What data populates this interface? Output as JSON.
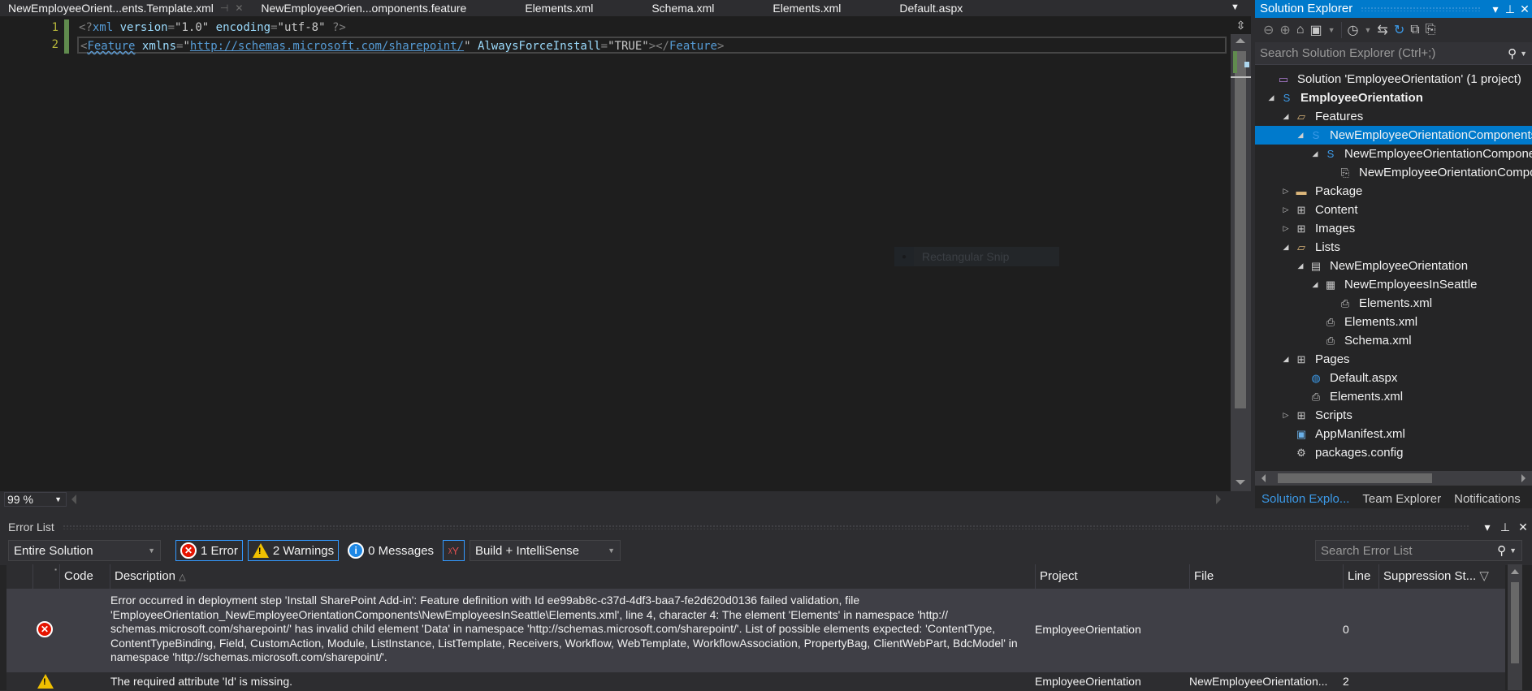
{
  "tabs": [
    {
      "label": "NewEmployeeOrient...ents.Template.xml",
      "active": true
    },
    {
      "label": "NewEmployeeOrien...omponents.feature"
    },
    {
      "label": "Elements.xml"
    },
    {
      "label": "Schema.xml"
    },
    {
      "label": "Elements.xml"
    },
    {
      "label": "Default.aspx"
    }
  ],
  "editor": {
    "line_numbers": [
      "1",
      "2"
    ],
    "line1": {
      "decl_open": "<?",
      "decl_name": "xml",
      "a1": "version",
      "v1": "\"1.0\"",
      "a2": "encoding",
      "v2": "\"utf-8\"",
      "decl_close": " ?>"
    },
    "line2": {
      "open": "<",
      "tag": "Feature",
      "a1": "xmlns",
      "eq": "=",
      "q": "\"",
      "url": "http://schemas.microsoft.com/sharepoint/",
      "a2": "AlwaysForceInstall",
      "v2": "\"TRUE\"",
      "close_open": "></",
      "close_tag": "Feature",
      "close_end": ">"
    },
    "overlay_label": "Rectangular Snip",
    "zoom_level": "99 %"
  },
  "solution_explorer": {
    "title": "Solution Explorer",
    "search_placeholder": "Search Solution Explorer (Ctrl+;)",
    "tree": [
      {
        "label": "Solution 'EmployeeOrientation' (1 project)",
        "depth": 0,
        "icon": "solution-icon",
        "toggle": ""
      },
      {
        "label": "EmployeeOrientation",
        "depth": 1,
        "icon": "sharepoint-project-icon",
        "toggle": "expanded",
        "bold": true
      },
      {
        "label": "Features",
        "depth": 2,
        "icon": "folder-open-icon",
        "toggle": "expanded"
      },
      {
        "label": "NewEmployeeOrientationComponents",
        "depth": 3,
        "icon": "feature-icon",
        "toggle": "expanded",
        "selected": true
      },
      {
        "label": "NewEmployeeOrientationComponents.feature",
        "depth": 4,
        "icon": "feature-icon",
        "toggle": "expanded"
      },
      {
        "label": "NewEmployeeOrientationComponents.Template.xml",
        "depth": 5,
        "icon": "template-file-icon",
        "toggle": ""
      },
      {
        "label": "Package",
        "depth": 2,
        "icon": "folder-icon",
        "toggle": "collapsed"
      },
      {
        "label": "Content",
        "depth": 2,
        "icon": "module-icon",
        "toggle": "collapsed"
      },
      {
        "label": "Images",
        "depth": 2,
        "icon": "module-icon",
        "toggle": "collapsed"
      },
      {
        "label": "Lists",
        "depth": 2,
        "icon": "folder-open-icon",
        "toggle": "expanded"
      },
      {
        "label": "NewEmployeeOrientation",
        "depth": 3,
        "icon": "list-definition-icon",
        "toggle": "expanded"
      },
      {
        "label": "NewEmployeesInSeattle",
        "depth": 4,
        "icon": "list-instance-icon",
        "toggle": "expanded"
      },
      {
        "label": "Elements.xml",
        "depth": 5,
        "icon": "xml-file-icon",
        "toggle": ""
      },
      {
        "label": "Elements.xml",
        "depth": 4,
        "icon": "xml-file-icon",
        "toggle": ""
      },
      {
        "label": "Schema.xml",
        "depth": 4,
        "icon": "xml-file-icon",
        "toggle": ""
      },
      {
        "label": "Pages",
        "depth": 2,
        "icon": "module-icon",
        "toggle": "expanded"
      },
      {
        "label": "Default.aspx",
        "depth": 3,
        "icon": "aspx-file-icon",
        "toggle": ""
      },
      {
        "label": "Elements.xml",
        "depth": 3,
        "icon": "xml-file-icon",
        "toggle": ""
      },
      {
        "label": "Scripts",
        "depth": 2,
        "icon": "module-icon",
        "toggle": "collapsed"
      },
      {
        "label": "AppManifest.xml",
        "depth": 2,
        "icon": "manifest-icon",
        "toggle": ""
      },
      {
        "label": "packages.config",
        "depth": 2,
        "icon": "config-file-icon",
        "toggle": ""
      }
    ],
    "bottom_tabs": [
      {
        "label": "Solution Explo...",
        "active": true
      },
      {
        "label": "Team Explorer"
      },
      {
        "label": "Notifications"
      }
    ]
  },
  "error_list": {
    "title": "Error List",
    "scope": "Entire Solution",
    "errors_label": "1 Error",
    "warnings_label": "2 Warnings",
    "messages_label": "0 Messages",
    "source": "Build + IntelliSense",
    "search_placeholder": "Search Error List",
    "columns": {
      "code": "Code",
      "description": "Description",
      "project": "Project",
      "file": "File",
      "line": "Line",
      "suppression": "Suppression St..."
    },
    "rows": [
      {
        "severity": "error",
        "code": "",
        "description": "Error occurred in deployment step 'Install SharePoint Add-in': Feature definition with Id ee99ab8c-c37d-4df3-baa7-fe2d620d0136 failed validation, file 'EmployeeOrientation_NewEmployeeOrientationComponents\\NewEmployeesInSeattle\\Elements.xml', line 4, character 4: The element 'Elements' in namespace 'http:// schemas.microsoft.com/sharepoint/' has invalid child element 'Data' in namespace 'http://schemas.microsoft.com/sharepoint/'. List of possible elements expected: 'ContentType, ContentTypeBinding, Field, CustomAction, Module, ListInstance, ListTemplate, Receivers, Workflow, WebTemplate, WorkflowAssociation, PropertyBag, ClientWebPart, BdcModel' in namespace 'http://schemas.microsoft.com/sharepoint/'.",
        "project": "EmployeeOrientation",
        "file": "",
        "line": "0",
        "suppression": ""
      },
      {
        "severity": "warning",
        "code": "",
        "description": "The required attribute 'Id' is missing.",
        "project": "EmployeeOrientation",
        "file": "NewEmployeeOrientation...",
        "line": "2",
        "suppression": ""
      }
    ]
  }
}
